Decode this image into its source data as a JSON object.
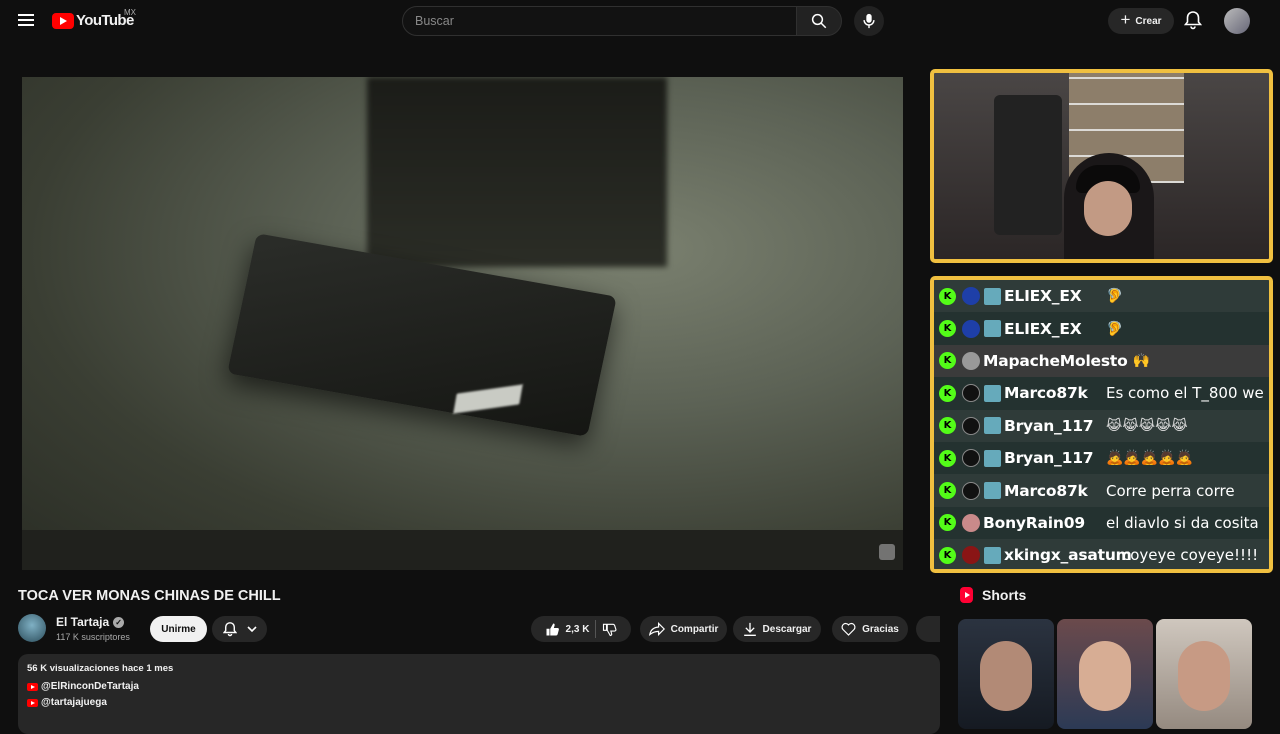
{
  "header": {
    "logo_text": "YouTube",
    "country": "MX",
    "search_placeholder": "Buscar",
    "create_label": "Crear"
  },
  "chat": [
    {
      "user": "ELIEX_EX",
      "message": "🦻"
    },
    {
      "user": "ELIEX_EX",
      "message": "🦻"
    },
    {
      "user": "MapacheMolesto",
      "message": "🙌"
    },
    {
      "user": "Marco87k",
      "message": "Es como el T_800 we"
    },
    {
      "user": "Bryan_117",
      "message": "😹😹😹😹😹"
    },
    {
      "user": "Bryan_117",
      "message": "🙇🙇🙇🙇🙇"
    },
    {
      "user": "Marco87k",
      "message": "Corre perra corre"
    },
    {
      "user": "BonyRain09",
      "message": "el diavlo si da cosita"
    },
    {
      "user": "xkingx_asatum",
      "message": "coyeye coyeye!!!!"
    }
  ],
  "video": {
    "title": "TOCA VER MONAS CHINAS DE CHILL",
    "channel": "El Tartaja",
    "subscribers": "117 K suscriptores",
    "join_label": "Unirme",
    "likes": "2,3 K",
    "share_label": "Compartir",
    "download_label": "Descargar",
    "thanks_label": "Gracias"
  },
  "description": {
    "meta": "56 K visualizaciones  hace 1 mes",
    "links": [
      "@ElRinconDeTartaja",
      "@tartajajuega"
    ]
  },
  "shorts": {
    "title": "Shorts"
  },
  "colors": {
    "brand_red": "#ff0000",
    "overlay_border": "#f0c040",
    "kick_green": "#53fc18"
  }
}
